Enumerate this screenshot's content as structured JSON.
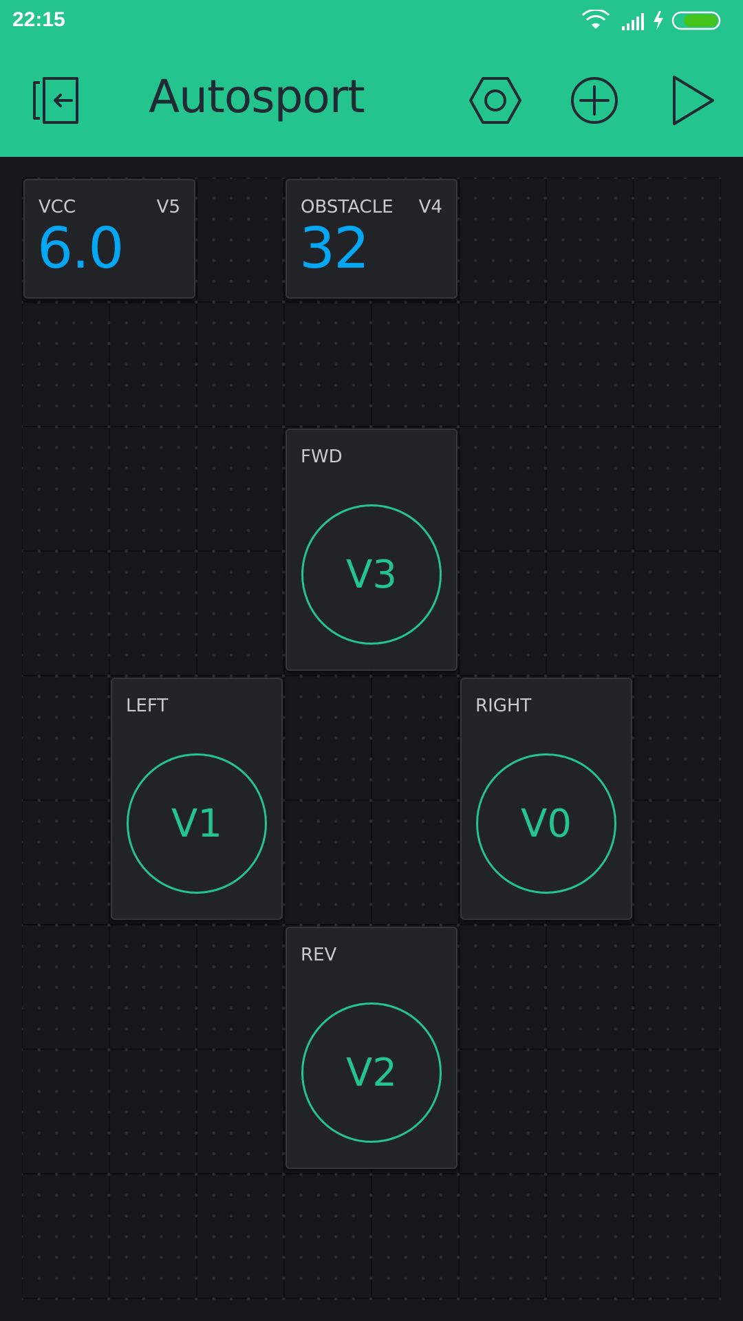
{
  "status_bar": {
    "time": "22:15",
    "icons": [
      "wifi-icon",
      "signal-icon",
      "charging-icon",
      "battery-icon"
    ],
    "battery_color": "#44c41a"
  },
  "app_bar": {
    "title": "Autosport",
    "icons": [
      "exit-icon",
      "settings-hexagon-icon",
      "add-circle-icon",
      "play-icon"
    ],
    "background": "#23c48e"
  },
  "widgets": {
    "vcc": {
      "label": "VCC",
      "pin": "V5",
      "value": "6.0"
    },
    "obstacle": {
      "label": "OBSTACLE",
      "pin": "V4",
      "value": "32"
    },
    "fwd": {
      "label": "FWD",
      "pin": "V3"
    },
    "left": {
      "label": "LEFT",
      "pin": "V1"
    },
    "right": {
      "label": "RIGHT",
      "pin": "V0"
    },
    "rev": {
      "label": "REV",
      "pin": "V2"
    }
  },
  "colors": {
    "accent": "#23c48e",
    "value_blue": "#04a7f4",
    "widget_bg": "#222327",
    "canvas_bg": "#16171b"
  }
}
